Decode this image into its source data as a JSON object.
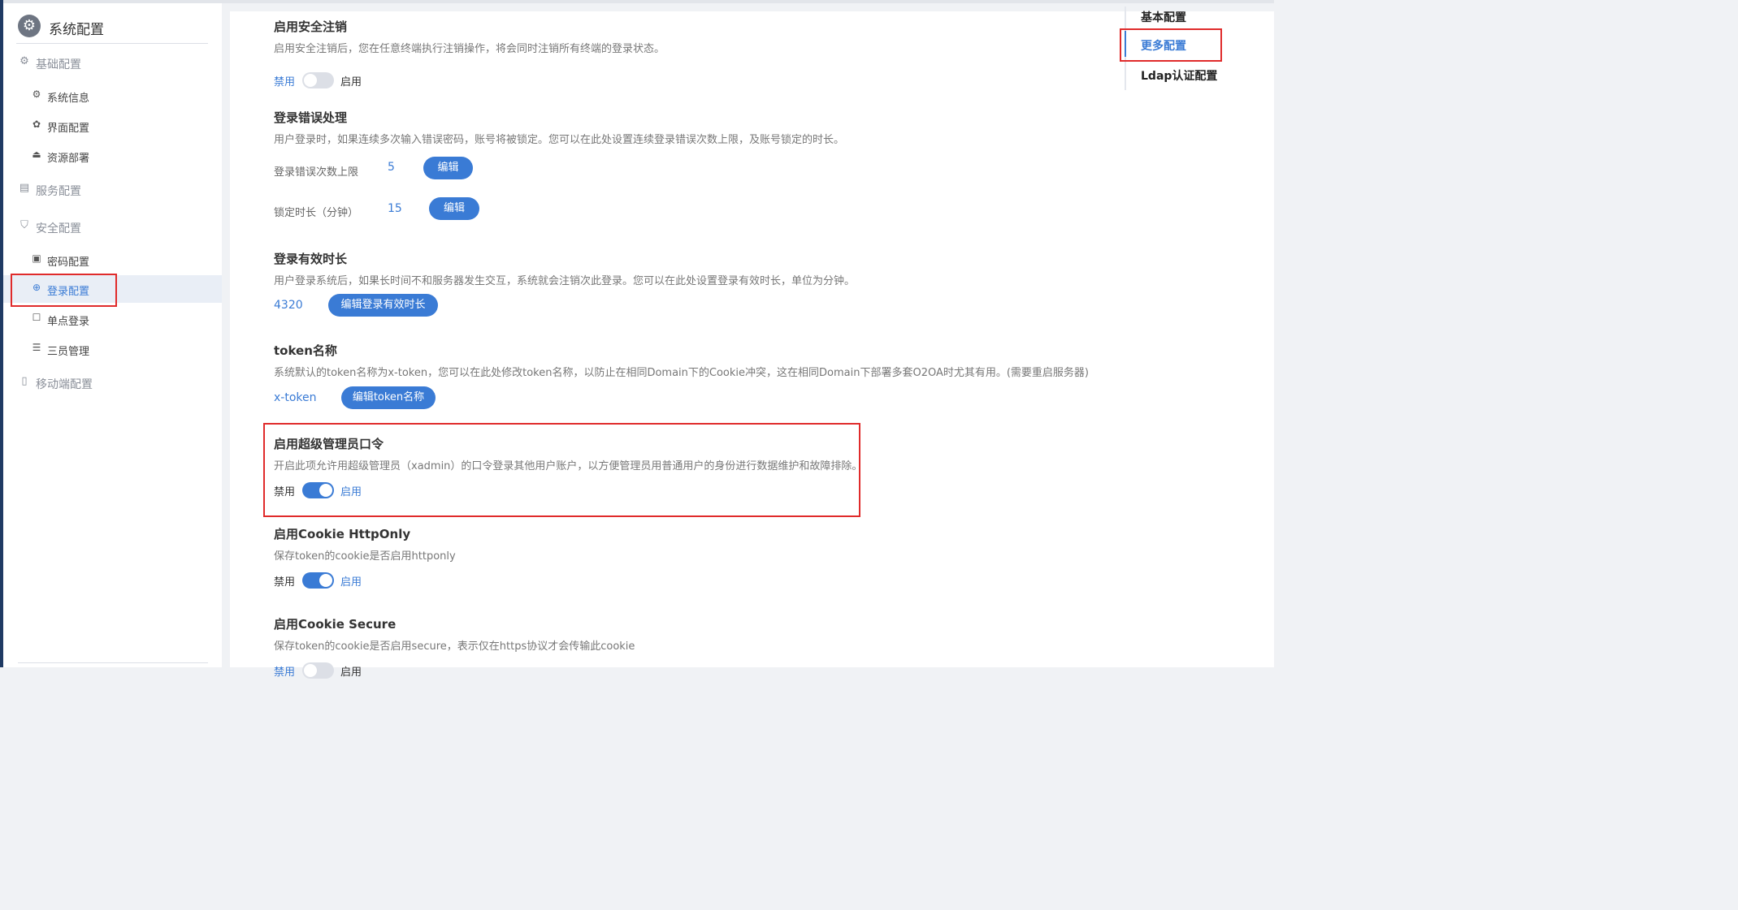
{
  "sidebar": {
    "header_title": "系统配置",
    "groups": [
      {
        "label": "基础配置",
        "icon": "gear-icon",
        "items": [
          {
            "label": "系统信息",
            "icon": "gear-icon"
          },
          {
            "label": "界面配置",
            "icon": "palette-icon"
          },
          {
            "label": "资源部署",
            "icon": "deploy-icon"
          }
        ]
      },
      {
        "label": "服务配置",
        "icon": "server-icon",
        "items": []
      },
      {
        "label": "安全配置",
        "icon": "shield-icon",
        "items": [
          {
            "label": "密码配置",
            "icon": "lock-icon"
          },
          {
            "label": "登录配置",
            "icon": "login-icon",
            "active": true
          },
          {
            "label": "单点登录",
            "icon": "user-card-icon"
          },
          {
            "label": "三员管理",
            "icon": "list-icon"
          }
        ]
      },
      {
        "label": "移动端配置",
        "icon": "mobile-icon",
        "items": []
      }
    ]
  },
  "anchor_nav": {
    "items": [
      {
        "label": "基本配置"
      },
      {
        "label": "更多配置",
        "active": true
      },
      {
        "label": "Ldap认证配置"
      }
    ]
  },
  "main": {
    "sections": {
      "safe_logout": {
        "title": "启用安全注销",
        "desc": "启用安全注销后，您在任意终端执行注销操作，将会同时注销所有终端的登录状态。",
        "off_label": "禁用",
        "on_label": "启用",
        "enabled": false
      },
      "login_error": {
        "title": "登录错误处理",
        "desc": "用户登录时，如果连续多次输入错误密码，账号将被锁定。您可以在此处设置连续登录错误次数上限，及账号锁定的时长。",
        "fields": [
          {
            "label": "登录错误次数上限",
            "value": "5",
            "button": "编辑"
          },
          {
            "label": "锁定时长（分钟）",
            "value": "15",
            "button": "编辑"
          }
        ]
      },
      "login_duration": {
        "title": "登录有效时长",
        "desc": "用户登录系统后，如果长时间不和服务器发生交互，系统就会注销次此登录。您可以在此处设置登录有效时长，单位为分钟。",
        "value": "4320",
        "button": "编辑登录有效时长"
      },
      "token_name": {
        "title": "token名称",
        "desc": "系统默认的token名称为x-token，您可以在此处修改token名称，以防止在相同Domain下的Cookie冲突，这在相同Domain下部署多套O2OA时尤其有用。(需要重启服务器)",
        "value": "x-token",
        "button": "编辑token名称"
      },
      "super_admin": {
        "title": "启用超级管理员口令",
        "desc": "开启此项允许用超级管理员（xadmin）的口令登录其他用户账户，以方便管理员用普通用户的身份进行数据维护和故障排除。",
        "off_label": "禁用",
        "on_label": "启用",
        "enabled": true
      },
      "cookie_httponly": {
        "title": "启用Cookie HttpOnly",
        "desc": "保存token的cookie是否启用httponly",
        "off_label": "禁用",
        "on_label": "启用",
        "enabled": true
      },
      "cookie_secure": {
        "title": "启用Cookie Secure",
        "desc": "保存token的cookie是否启用secure，表示仅在https协议才会传输此cookie",
        "off_label": "禁用",
        "on_label": "启用",
        "enabled": false
      }
    }
  },
  "colors": {
    "accent": "#3a7bd5",
    "highlight_box": "#e02b2b",
    "sidebar_bg": "#ffffff",
    "page_bg": "#f0f2f5"
  }
}
